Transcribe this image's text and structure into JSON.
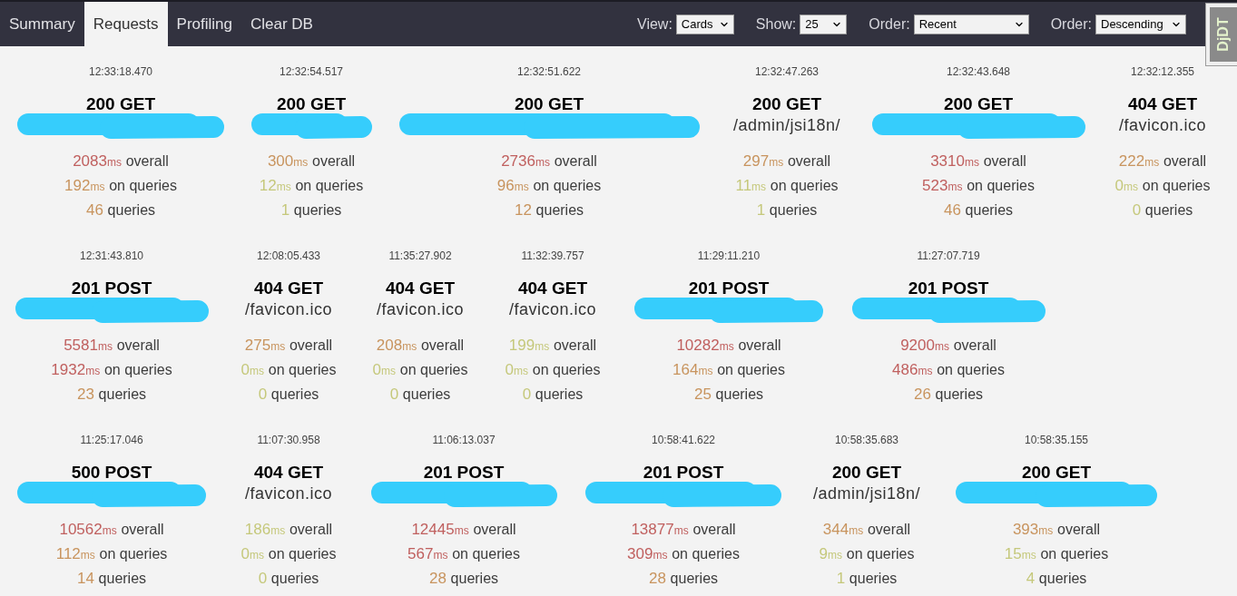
{
  "nav": {
    "tabs": [
      {
        "label": "Summary",
        "selected": false
      },
      {
        "label": "Requests",
        "selected": true
      },
      {
        "label": "Profiling",
        "selected": false
      },
      {
        "label": "Clear DB",
        "selected": false
      }
    ]
  },
  "filters": [
    {
      "label": "View:",
      "value": "Cards"
    },
    {
      "label": "Show:",
      "value": "25"
    },
    {
      "label": "Order:",
      "value": "Recent"
    },
    {
      "label": "Order:",
      "value": "Descending"
    }
  ],
  "debug_toolbar": {
    "label": "DjDT"
  },
  "requests": [
    {
      "time": "12:33:18.470",
      "title": "200 GET",
      "redacted": true,
      "metrics": [
        {
          "amount": "2083",
          "unit": "ms",
          "caption": "overall",
          "color": "#c0605f"
        },
        {
          "amount": "192",
          "unit": "ms",
          "caption": "on queries",
          "color": "#c8945e"
        },
        {
          "amount": "46",
          "caption": "queries",
          "color": "#c8945e"
        }
      ]
    },
    {
      "time": "12:32:54.517",
      "title": "200 GET",
      "redacted": true,
      "metrics": [
        {
          "amount": "300",
          "unit": "ms",
          "caption": "overall",
          "color": "#c8945e"
        },
        {
          "amount": "12",
          "unit": "ms",
          "caption": "on queries",
          "color": "#c5c87b"
        },
        {
          "amount": "1",
          "caption": "queries",
          "color": "#c5c87b"
        }
      ]
    },
    {
      "time": "12:32:51.622",
      "title": "200 GET",
      "redacted": true,
      "metrics": [
        {
          "amount": "2736",
          "unit": "ms",
          "caption": "overall",
          "color": "#c0605f"
        },
        {
          "amount": "96",
          "unit": "ms",
          "caption": "on queries",
          "color": "#c8945e"
        },
        {
          "amount": "12",
          "caption": "queries",
          "color": "#c8945e"
        }
      ]
    },
    {
      "time": "12:32:47.263",
      "title": "200 GET",
      "redacted": false,
      "path": "/admin/jsi18n/",
      "metrics": [
        {
          "amount": "297",
          "unit": "ms",
          "caption": "overall",
          "color": "#c8945e"
        },
        {
          "amount": "11",
          "unit": "ms",
          "caption": "on queries",
          "color": "#c5c87b"
        },
        {
          "amount": "1",
          "caption": "queries",
          "color": "#c5c87b"
        }
      ]
    },
    {
      "time": "12:32:43.648",
      "title": "200 GET",
      "redacted": true,
      "metrics": [
        {
          "amount": "3310",
          "unit": "ms",
          "caption": "overall",
          "color": "#c0605f"
        },
        {
          "amount": "523",
          "unit": "ms",
          "caption": "on queries",
          "color": "#c0605f"
        },
        {
          "amount": "46",
          "caption": "queries",
          "color": "#c8945e"
        }
      ]
    },
    {
      "time": "12:32:12.355",
      "title": "404 GET",
      "redacted": false,
      "path": "/favicon.ico",
      "metrics": [
        {
          "amount": "222",
          "unit": "ms",
          "caption": "overall",
          "color": "#c8945e"
        },
        {
          "amount": "0",
          "unit": "ms",
          "caption": "on queries",
          "color": "#c5c87b"
        },
        {
          "amount": "0",
          "caption": "queries",
          "color": "#c5c87b"
        }
      ]
    },
    {
      "time": "12:31:43.810",
      "title": "201 POST",
      "redacted": true,
      "metrics": [
        {
          "amount": "5581",
          "unit": "ms",
          "caption": "overall",
          "color": "#c0605f"
        },
        {
          "amount": "1932",
          "unit": "ms",
          "caption": "on queries",
          "color": "#c0605f"
        },
        {
          "amount": "23",
          "caption": "queries",
          "color": "#c8945e"
        }
      ]
    },
    {
      "time": "12:08:05.433",
      "title": "404 GET",
      "redacted": false,
      "path": "/favicon.ico",
      "metrics": [
        {
          "amount": "275",
          "unit": "ms",
          "caption": "overall",
          "color": "#c8945e"
        },
        {
          "amount": "0",
          "unit": "ms",
          "caption": "on queries",
          "color": "#c5c87b"
        },
        {
          "amount": "0",
          "caption": "queries",
          "color": "#c5c87b"
        }
      ]
    },
    {
      "time": "11:35:27.902",
      "title": "404 GET",
      "redacted": false,
      "path": "/favicon.ico",
      "metrics": [
        {
          "amount": "208",
          "unit": "ms",
          "caption": "overall",
          "color": "#c8945e"
        },
        {
          "amount": "0",
          "unit": "ms",
          "caption": "on queries",
          "color": "#c5c87b"
        },
        {
          "amount": "0",
          "caption": "queries",
          "color": "#c5c87b"
        }
      ]
    },
    {
      "time": "11:32:39.757",
      "title": "404 GET",
      "redacted": false,
      "path": "/favicon.ico",
      "metrics": [
        {
          "amount": "199",
          "unit": "ms",
          "caption": "overall",
          "color": "#c5c87b"
        },
        {
          "amount": "0",
          "unit": "ms",
          "caption": "on queries",
          "color": "#c5c87b"
        },
        {
          "amount": "0",
          "caption": "queries",
          "color": "#c5c87b"
        }
      ]
    },
    {
      "time": "11:29:11.210",
      "title": "201 POST",
      "redacted": true,
      "metrics": [
        {
          "amount": "10282",
          "unit": "ms",
          "caption": "overall",
          "color": "#c0605f"
        },
        {
          "amount": "164",
          "unit": "ms",
          "caption": "on queries",
          "color": "#c8945e"
        },
        {
          "amount": "25",
          "caption": "queries",
          "color": "#c8945e"
        }
      ]
    },
    {
      "time": "11:27:07.719",
      "title": "201 POST",
      "redacted": true,
      "metrics": [
        {
          "amount": "9200",
          "unit": "ms",
          "caption": "overall",
          "color": "#c0605f"
        },
        {
          "amount": "486",
          "unit": "ms",
          "caption": "on queries",
          "color": "#c0605f"
        },
        {
          "amount": "26",
          "caption": "queries",
          "color": "#c8945e"
        }
      ]
    },
    {
      "time": "11:25:17.046",
      "title": "500 POST",
      "redacted": true,
      "metrics": [
        {
          "amount": "10562",
          "unit": "ms",
          "caption": "overall",
          "color": "#c0605f"
        },
        {
          "amount": "112",
          "unit": "ms",
          "caption": "on queries",
          "color": "#c8945e"
        },
        {
          "amount": "14",
          "caption": "queries",
          "color": "#c8945e"
        }
      ]
    },
    {
      "time": "11:07:30.958",
      "title": "404 GET",
      "redacted": false,
      "path": "/favicon.ico",
      "metrics": [
        {
          "amount": "186",
          "unit": "ms",
          "caption": "overall",
          "color": "#c5c87b"
        },
        {
          "amount": "0",
          "unit": "ms",
          "caption": "on queries",
          "color": "#c5c87b"
        },
        {
          "amount": "0",
          "caption": "queries",
          "color": "#c5c87b"
        }
      ]
    },
    {
      "time": "11:06:13.037",
      "title": "201 POST",
      "redacted": true,
      "metrics": [
        {
          "amount": "12445",
          "unit": "ms",
          "caption": "overall",
          "color": "#c0605f"
        },
        {
          "amount": "567",
          "unit": "ms",
          "caption": "on queries",
          "color": "#c0605f"
        },
        {
          "amount": "28",
          "caption": "queries",
          "color": "#c8945e"
        }
      ]
    },
    {
      "time": "10:58:41.622",
      "title": "201 POST",
      "redacted": true,
      "metrics": [
        {
          "amount": "13877",
          "unit": "ms",
          "caption": "overall",
          "color": "#c0605f"
        },
        {
          "amount": "309",
          "unit": "ms",
          "caption": "on queries",
          "color": "#c0605f"
        },
        {
          "amount": "28",
          "caption": "queries",
          "color": "#c8945e"
        }
      ]
    },
    {
      "time": "10:58:35.683",
      "title": "200 GET",
      "redacted": false,
      "path": "/admin/jsi18n/",
      "metrics": [
        {
          "amount": "344",
          "unit": "ms",
          "caption": "overall",
          "color": "#c8945e"
        },
        {
          "amount": "9",
          "unit": "ms",
          "caption": "on queries",
          "color": "#c5c87b"
        },
        {
          "amount": "1",
          "caption": "queries",
          "color": "#c5c87b"
        }
      ]
    },
    {
      "time": "10:58:35.155",
      "title": "200 GET",
      "redacted": true,
      "metrics": [
        {
          "amount": "393",
          "unit": "ms",
          "caption": "overall",
          "color": "#c8945e"
        },
        {
          "amount": "15",
          "unit": "ms",
          "caption": "on queries",
          "color": "#c5c87b"
        },
        {
          "amount": "4",
          "caption": "queries",
          "color": "#c5c87b"
        }
      ]
    }
  ]
}
